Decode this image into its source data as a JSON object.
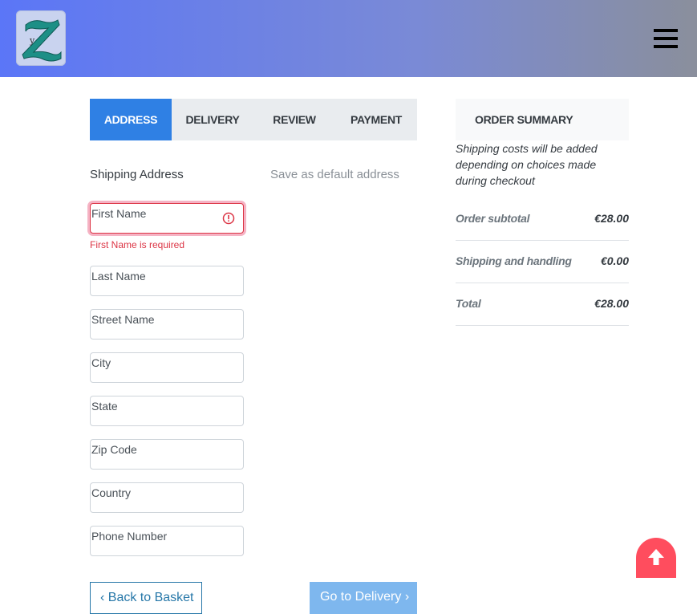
{
  "header": {
    "logo_alt": "yZ logo",
    "menu_icon": "hamburger-icon"
  },
  "tabs": [
    {
      "label": "ADDRESS",
      "active": true
    },
    {
      "label": "DELIVERY",
      "active": false
    },
    {
      "label": "REVIEW",
      "active": false
    },
    {
      "label": "PAYMENT",
      "active": false
    }
  ],
  "form": {
    "section_label": "Shipping Address",
    "save_default_label": "Save as default address",
    "fields": [
      {
        "label": "First Name",
        "value": "",
        "error": "First Name is required"
      },
      {
        "label": "Last Name",
        "value": ""
      },
      {
        "label": "Street Name",
        "value": ""
      },
      {
        "label": "City",
        "value": ""
      },
      {
        "label": "State",
        "value": ""
      },
      {
        "label": "Zip Code",
        "value": ""
      },
      {
        "label": "Country",
        "value": ""
      },
      {
        "label": "Phone Number",
        "value": ""
      }
    ],
    "back_label": "Back to Basket",
    "next_label": "Go to Delivery"
  },
  "summary": {
    "title": "ORDER SUMMARY",
    "note": "Shipping costs will be added depending on choices made during checkout",
    "rows": [
      {
        "label": "Order subtotal",
        "value": "€28.00"
      },
      {
        "label": "Shipping and handling",
        "value": "€0.00"
      },
      {
        "label": "Total",
        "value": "€28.00"
      }
    ]
  },
  "colors": {
    "accent": "#2f80e4",
    "error": "#dc3545",
    "scroll_top": "#ff4d5e"
  }
}
